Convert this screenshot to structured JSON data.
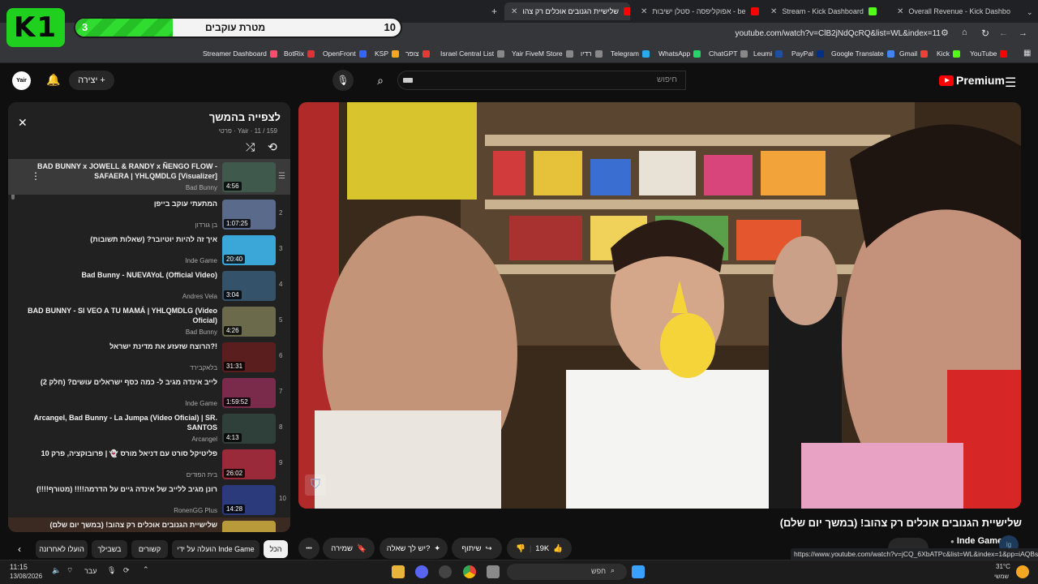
{
  "browser": {
    "tabs": [
      {
        "label": "שלישיית הגנובים אוכלים רק צהו",
        "icon": "youtube-icon",
        "active": true
      },
      {
        "label": "אפוקליפסה - סטלן ישיבות - be",
        "icon": "youtube-icon",
        "active": false
      },
      {
        "label": "Stream - Kick Dashboard",
        "icon": "kick-icon",
        "active": false
      },
      {
        "label": "Overall Revenue - Kick Dashbo",
        "icon": "kick-icon",
        "active": false
      }
    ],
    "new_tab": "+",
    "url": "youtube.com/watch?v=ClB2jNdQcRQ&list=WL&index=11",
    "bookmarks": [
      {
        "label": "Streamer Dashboard",
        "color": "#ff4d6d"
      },
      {
        "label": "BotRix",
        "color": "#d33"
      },
      {
        "label": "OpenFront",
        "color": "#3366ff"
      },
      {
        "label": "KSP",
        "color": "#f5a623"
      },
      {
        "label": "צופר",
        "color": "#e53935"
      },
      {
        "label": "Israel Central List",
        "color": "#888"
      },
      {
        "label": "Yair FiveM Store",
        "color": "#888"
      },
      {
        "label": "רדיו",
        "color": "#888"
      },
      {
        "label": "Telegram",
        "color": "#2aabee"
      },
      {
        "label": "WhatsApp",
        "color": "#25d366"
      },
      {
        "label": "ChatGPT",
        "color": "#888"
      },
      {
        "label": "Leumi",
        "color": "#1e4fa0"
      },
      {
        "label": "PayPal",
        "color": "#003087"
      },
      {
        "label": "Google Translate",
        "color": "#4285f4"
      },
      {
        "label": "Gmail",
        "color": "#ea4335"
      },
      {
        "label": "Kick",
        "color": "#53fc18"
      },
      {
        "label": "YouTube",
        "color": "#ff0000"
      }
    ]
  },
  "overlay": {
    "logo": "K1",
    "goal_label": "מטרת עוקבים",
    "goal_current": "3",
    "goal_target": "10",
    "goal_progress": 0.3
  },
  "header": {
    "logo_text": "Premium",
    "search_placeholder": "חיפוש",
    "create_label": "יצירה",
    "avatar_text": "Yair"
  },
  "playlist": {
    "title": "לצפייה בהמשך",
    "meta": "פרטי · Yair · 11 / 159",
    "items": [
      {
        "title": "BAD BUNNY x JOWELL & RANDY x ÑENGO FLOW - SAFAERA | YHLQMDLG [Visualizer]",
        "channel": "Bad Bunny",
        "duration": "4:56",
        "index": "",
        "thumb": "#3f5a4c",
        "current": true
      },
      {
        "title": "המתעתי עוקב בייפן",
        "channel": "בן גורדון",
        "duration": "1:07:25",
        "index": "2",
        "thumb": "#5a6a8a",
        "current": false
      },
      {
        "title": "איך זה להיות יוטיובר? (שאלות תשובות)",
        "channel": "Inde Game",
        "duration": "20:40",
        "index": "3",
        "thumb": "#3aa7d8",
        "current": false
      },
      {
        "title": "Bad Bunny - NUEVAYoL (Official Video)",
        "channel": "Andres Vela",
        "duration": "3:04",
        "index": "4",
        "thumb": "#34536b",
        "current": false
      },
      {
        "title": "BAD BUNNY - SI VEO A TU MAMÁ | YHLQMDLG (Video Oficial)",
        "channel": "Bad Bunny",
        "duration": "4:26",
        "index": "5",
        "thumb": "#6b6a4a",
        "current": false
      },
      {
        "title": "הרוצח שזעזע את מדינת ישראל?!",
        "channel": "בלאקבירד",
        "duration": "31:31",
        "index": "6",
        "thumb": "#5a1e1e",
        "current": false
      },
      {
        "title": "לייב אינדה מגיב ל- כמה כסף ישראלים עושים? (חלק 2)",
        "channel": "Inde Game",
        "duration": "1:59:52",
        "index": "7",
        "thumb": "#7a2a4a",
        "current": false
      },
      {
        "title": "Arcangel, Bad Bunny - La Jumpa (Video Oficial) | SR. SANTOS",
        "channel": "Arcangel",
        "duration": "4:13",
        "index": "8",
        "thumb": "#2f3f3a",
        "current": false
      },
      {
        "title": "פליטיקל סורט עם דניאל מורס 👻 | פרובוקציה, פרק 10",
        "channel": "בית הפודים",
        "duration": "26:02",
        "index": "9",
        "thumb": "#9a2a3a",
        "current": false
      },
      {
        "title": "רונן מגיב ללייב של אינדה גיים על הדרמה!!!! (מטורף!!!!)",
        "channel": "RonenGG Plus",
        "duration": "14:28",
        "index": "10",
        "thumb": "#2a3a7a",
        "current": false
      },
      {
        "title": "שלישיית הגנובים אוכלים רק צהוב! (במשך יום שלם)",
        "channel": "",
        "duration": "",
        "index": "",
        "thumb": "#b89a3a",
        "current": false
      }
    ]
  },
  "video": {
    "title": "שלישיית הגנובים אוכלים רק צהוב! (במשך יום שלם)",
    "likes": "19K",
    "share_label": "שיתוף",
    "ask_label": "יש לך שאלה?",
    "save_label": "שמירה",
    "more_label": "•••",
    "channel_name": "Inde Game",
    "watermark": "⛉"
  },
  "chips": [
    "הכל",
    "הועלה על ידי Inde Game",
    "קשורים",
    "בשבילך",
    "הועלו לאחרונה"
  ],
  "status_url": "https://www.youtube.com/watch?v=jCQ_6XbATPc&list=WL&index=1&pp=iAQBsAgC",
  "taskbar": {
    "time": "11:15",
    "date": "13/08/2026",
    "lang": "עבר",
    "search_placeholder": "חפש",
    "weather_temp": "31°C",
    "weather_text": "שמשי"
  }
}
